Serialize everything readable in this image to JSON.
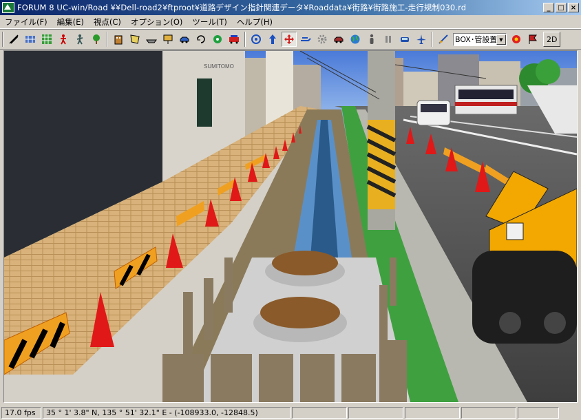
{
  "window": {
    "title": "FORUM 8   UC-win/Road   ¥¥Dell-road2¥ftproot¥道路デザイン指針関連データ¥Roaddata¥街路¥街路施工-走行規制030.rd",
    "min_label": "_",
    "max_label": "□",
    "close_label": "×"
  },
  "menu": [
    {
      "label": "ファイル(F)"
    },
    {
      "label": "編集(E)"
    },
    {
      "label": "視点(C)"
    },
    {
      "label": "オプション(O)"
    },
    {
      "label": "ツール(T)"
    },
    {
      "label": "ヘルプ(H)"
    }
  ],
  "toolbar": {
    "mode_select": "BOX･管設置",
    "btn_2d": "2D"
  },
  "scene": {
    "sign_text": "SUMITOMO"
  },
  "status": {
    "fps": "17.0 fps",
    "coords": "35 °   1' 3.8\" N, 135 °   51' 32.1\" E  -  (-108933.0, -12848.5)"
  },
  "colors": {
    "titlebar_start": "#0a246a",
    "titlebar_end": "#a6caf0",
    "ui_face": "#d4d0c8",
    "cone": "#e01818",
    "barrier": "#f0a020",
    "excavator": "#f2a800"
  }
}
